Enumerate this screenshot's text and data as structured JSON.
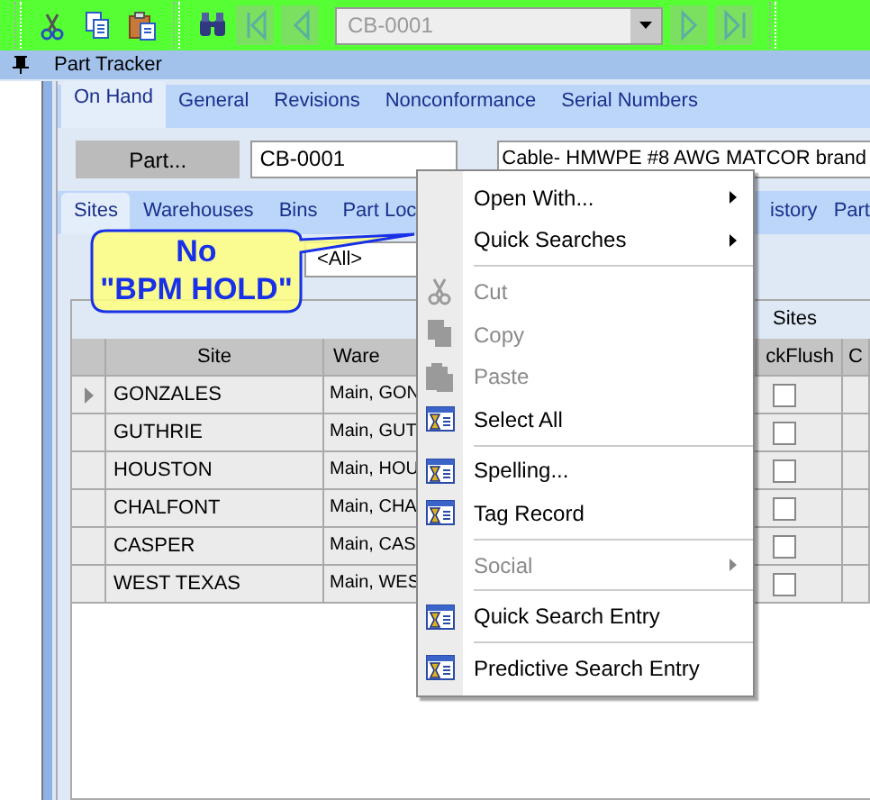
{
  "toolbar": {
    "record_combo": {
      "value": "CB-0001"
    }
  },
  "panel": {
    "title": "Part Tracker"
  },
  "tabs": [
    {
      "label": "On Hand",
      "selected": true
    },
    {
      "label": "General",
      "selected": false
    },
    {
      "label": "Revisions",
      "selected": false
    },
    {
      "label": "Nonconformance",
      "selected": false
    },
    {
      "label": "Serial Numbers",
      "selected": false
    }
  ],
  "part": {
    "button": "Part...",
    "number": "CB-0001",
    "description": "Cable- HMWPE #8  AWG MATCOR brand"
  },
  "subtabs": [
    {
      "label": "Sites",
      "selected": true
    },
    {
      "label": "Warehouses",
      "selected": false
    },
    {
      "label": "Bins",
      "selected": false
    },
    {
      "label": "Part Loc",
      "selected": false
    },
    {
      "label": "istory",
      "selected": false
    },
    {
      "label": "Part",
      "selected": false
    }
  ],
  "filter": {
    "value": "<All>"
  },
  "grid": {
    "group_header": "Sites",
    "columns": [
      "Site",
      "Ware",
      "ckFlush",
      "C"
    ],
    "rows": [
      {
        "site": "GONZALES",
        "warehouse": "Main, GON",
        "backflush": false,
        "current": true
      },
      {
        "site": "GUTHRIE",
        "warehouse": "Main, GUT",
        "backflush": false,
        "current": false
      },
      {
        "site": "HOUSTON",
        "warehouse": "Main, HOU",
        "backflush": false,
        "current": false
      },
      {
        "site": "CHALFONT",
        "warehouse": "Main, CHA",
        "backflush": false,
        "current": false
      },
      {
        "site": "CASPER",
        "warehouse": "Main, CAS",
        "backflush": false,
        "current": false
      },
      {
        "site": "WEST TEXAS",
        "warehouse": "Main, WES",
        "backflush": false,
        "current": false
      }
    ]
  },
  "callout": {
    "lines": [
      "No",
      "\"BPM HOLD\""
    ]
  },
  "context_menu": {
    "items": [
      {
        "kind": "submenu",
        "label": "Open With...",
        "disabled": false
      },
      {
        "kind": "submenu",
        "label": "Quick Searches",
        "disabled": false
      },
      {
        "kind": "separator"
      },
      {
        "kind": "cut",
        "label": "Cut",
        "disabled": true
      },
      {
        "kind": "copy",
        "label": "Copy",
        "disabled": true
      },
      {
        "kind": "paste",
        "label": "Paste",
        "disabled": true
      },
      {
        "kind": "command",
        "label": "Select All",
        "disabled": false
      },
      {
        "kind": "separator"
      },
      {
        "kind": "command",
        "label": "Spelling...",
        "disabled": false
      },
      {
        "kind": "command",
        "label": "Tag Record",
        "disabled": false
      },
      {
        "kind": "separator"
      },
      {
        "kind": "submenu",
        "label": "Social",
        "disabled": true
      },
      {
        "kind": "separator"
      },
      {
        "kind": "command",
        "label": "Quick Search Entry",
        "disabled": false
      },
      {
        "kind": "separator"
      },
      {
        "kind": "command",
        "label": "Predictive Search Entry",
        "disabled": false
      }
    ]
  }
}
